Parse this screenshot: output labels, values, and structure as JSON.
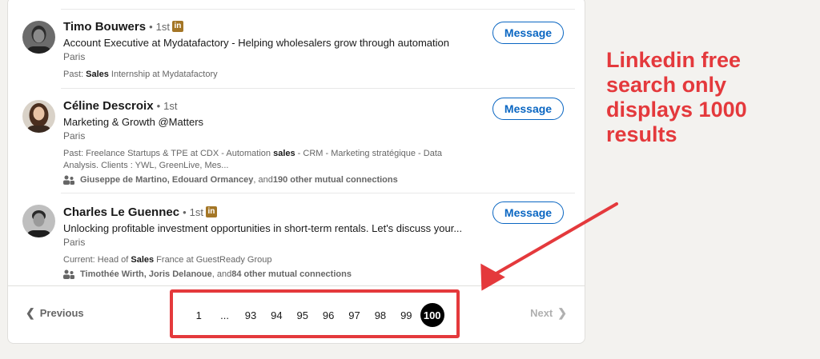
{
  "results": [
    {
      "name": "Timo Bouwers",
      "dot": "•",
      "degree": "1st",
      "badge": "in",
      "headline": "Account Executive at Mydatafactory - Helping wholesalers grow through automation",
      "location": "Paris",
      "snippet_prefix": "Past: ",
      "snippet_bold": "Sales",
      "snippet_suffix": " Internship at Mydatafactory",
      "action": "Message"
    },
    {
      "name": "Céline Descroix",
      "dot": "•",
      "degree": "1st",
      "headline": "Marketing & Growth @Matters",
      "location": "Paris",
      "snippet_prefix": "Past: Freelance Startups & TPE at CDX - Automation ",
      "snippet_bold": "sales",
      "snippet_suffix": " - CRM - Marketing stratégique - Data Analysis. Clients : YWL, GreenLive, Mes...",
      "mutual_names": "Giuseppe de Martino, Edouard Ormancey",
      "mutual_and": ", and ",
      "mutual_count": "190 other mutual connections",
      "action": "Message"
    },
    {
      "name": "Charles Le Guennec",
      "dot": "•",
      "degree": "1st",
      "badge": "in",
      "headline": "Unlocking profitable investment opportunities in short-term rentals. Let's discuss your...",
      "location": "Paris",
      "snippet_prefix": "Current: Head of ",
      "snippet_bold": "Sales",
      "snippet_suffix": " France at GuestReady Group",
      "mutual_names": "Timothée Wirth, Joris Delanoue",
      "mutual_and": ", and ",
      "mutual_count": "84 other mutual connections",
      "action": "Message"
    }
  ],
  "pagination": {
    "previous": "Previous",
    "next": "Next",
    "prev_chevron": "❮",
    "next_chevron": "❯",
    "pages": [
      "1",
      "...",
      "93",
      "94",
      "95",
      "96",
      "97",
      "98",
      "99",
      "100"
    ],
    "current": "100"
  },
  "annotation": {
    "text": "Linkedin free search only displays 1000 results",
    "color": "#e4393c"
  },
  "colors": {
    "accent": "#0a66c2",
    "badge": "#a47626",
    "annotation": "#e4393c"
  }
}
